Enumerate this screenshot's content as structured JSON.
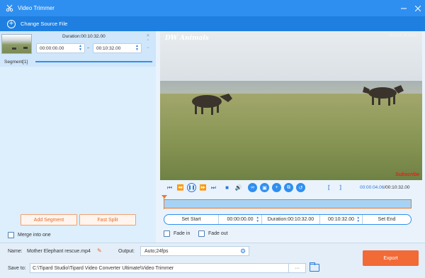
{
  "window": {
    "title": "Video Trimmer"
  },
  "toolbar": {
    "change_source_label": "Change Source File"
  },
  "segment": {
    "label": "Segment[1]",
    "duration": "Duration:00:10:32.00",
    "start": "00:00:00.00",
    "end": "00:10:32.00",
    "dash": "–"
  },
  "left_actions": {
    "add_segment": "Add Segment",
    "fast_split": "Fast Split",
    "merge_label": "Merge into one"
  },
  "video": {
    "watermark_left": "DW Animals",
    "watermark_right": "Reine Anime",
    "subscribe": "Subscribe"
  },
  "playback": {
    "current_time": "00:00:04.06",
    "total_time": "/00:10:32.00",
    "icons": [
      "skip-start-icon",
      "rewind-icon",
      "play-icon",
      "fast-forward-icon",
      "skip-end-icon",
      "stop-icon",
      "volume-icon",
      "loop-icon",
      "screenshot-icon",
      "add-icon",
      "copy-icon",
      "reset-icon",
      "trim-left-icon",
      "trim-right-icon"
    ]
  },
  "set_bar": {
    "set_start": "Set Start",
    "start_time": "00:00:00.00",
    "duration": "Duration:00:10:32.00",
    "end_time": "00:10:32.00",
    "set_end": "Set End"
  },
  "fades": {
    "fade_in": "Fade in",
    "fade_out": "Fade out"
  },
  "footer": {
    "name_label": "Name:",
    "name_value": "Mother Elephant rescue.mp4",
    "output_label": "Output:",
    "output_value": "Auto;24fps",
    "save_label": "Save to:",
    "save_value": "C:\\Tipard Studio\\Tipard Video Converter Ultimate\\Video Trimmer",
    "more": "···",
    "export_label": "Export"
  },
  "colors": {
    "accent": "#2f8ff0",
    "orange": "#f26a36",
    "titlebar": "#2f8ff0"
  }
}
